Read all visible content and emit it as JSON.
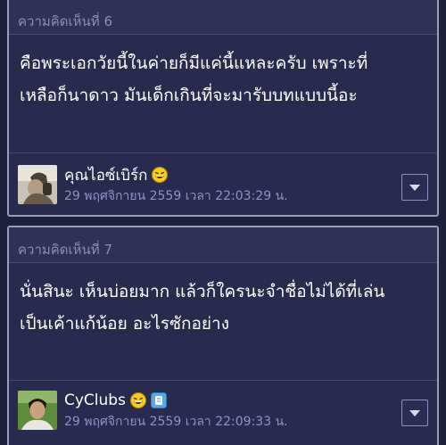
{
  "comments": [
    {
      "header": "ความคิดเห็นที่ 6",
      "body_lines": [
        "คือพระเอกวัยนี้ในค่ายก็มีแค่นี้แหละครับ เพราะที่",
        "เหลือก็นาดาว มันเด็กเกินที่จะมารับบทแบบนี้อะ"
      ],
      "author": "คุณไอซ์เบิร์ก",
      "timestamp": "29 พฤศจิกายน 2559 เวลา 22:03:29 น.",
      "emoji_icon": "laughing-emoji-icon",
      "avatar_icon": "user-avatar-photo"
    },
    {
      "header": "ความคิดเห็นที่ 7",
      "body_lines": [
        "นั่นสินะ เห็นบ่อยมาก แล้วก็ใครนะจำชื่อไม่ได้ที่เล่น",
        "เป็นเค้าแก้น้อย อะไรซักอย่าง"
      ],
      "author": "CyClubs",
      "timestamp": "29 พฤศจิกายน 2559 เวลา 22:09:33 น.",
      "emoji_icon": "laughing-emoji-icon",
      "badge_icon": "blogger-badge-icon",
      "avatar_icon": "user-avatar-photo"
    }
  ],
  "colors": {
    "background": "#1d1f3b",
    "card": "#282a4e",
    "header_text": "#8b8fb6",
    "date_text": "#8d93c4",
    "border": "#9a9cb8"
  }
}
